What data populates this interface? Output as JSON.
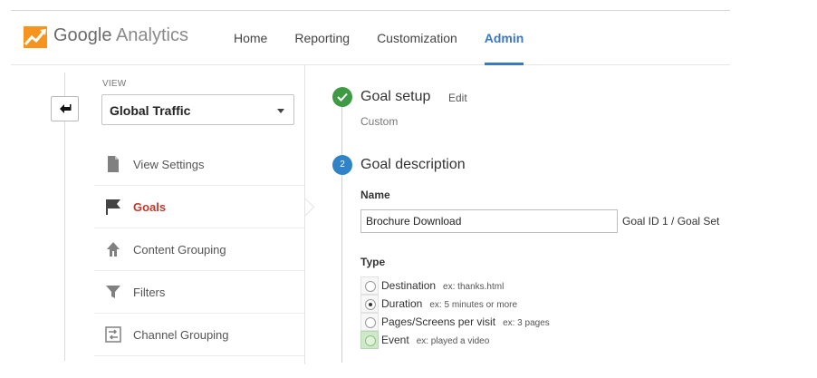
{
  "header": {
    "logo": {
      "brand": "Google",
      "product": "Analytics"
    },
    "nav": [
      {
        "label": "Home"
      },
      {
        "label": "Reporting"
      },
      {
        "label": "Customization"
      },
      {
        "label": "Admin",
        "active": true
      }
    ],
    "accent_color": "#3b78c3"
  },
  "sidebar": {
    "back_icon": "back-arrow-icon",
    "view_label": "VIEW",
    "view_select": {
      "value": "Global Traffic"
    },
    "items": [
      {
        "label": "View Settings",
        "icon": "document-icon"
      },
      {
        "label": "Goals",
        "icon": "flag-icon",
        "active": true
      },
      {
        "label": "Content Grouping",
        "icon": "person-walking-icon"
      },
      {
        "label": "Filters",
        "icon": "funnel-icon"
      },
      {
        "label": "Channel Grouping",
        "icon": "channel-grouping-icon"
      }
    ],
    "active_color": "#c1392b"
  },
  "goal_setup": {
    "title": "Goal setup",
    "edit": "Edit",
    "value": "Custom",
    "status_color": "#3f9b43"
  },
  "goal_description": {
    "step_number": "2",
    "title": "Goal description",
    "name_label": "Name",
    "name_value": "Brochure Download",
    "goal_id_text": "Goal ID 1 / Goal Set",
    "type_label": "Type",
    "types": [
      {
        "label": "Destination",
        "example": "ex: thanks.html",
        "checked": false,
        "highlighted": false
      },
      {
        "label": "Duration",
        "example": "ex: 5 minutes or more",
        "checked": true,
        "highlighted": false
      },
      {
        "label": "Pages/Screens per visit",
        "example": "ex: 3 pages",
        "checked": false,
        "highlighted": false
      },
      {
        "label": "Event",
        "example": "ex: played a video",
        "checked": false,
        "highlighted": true
      }
    ],
    "step_color": "#2f83c6"
  }
}
